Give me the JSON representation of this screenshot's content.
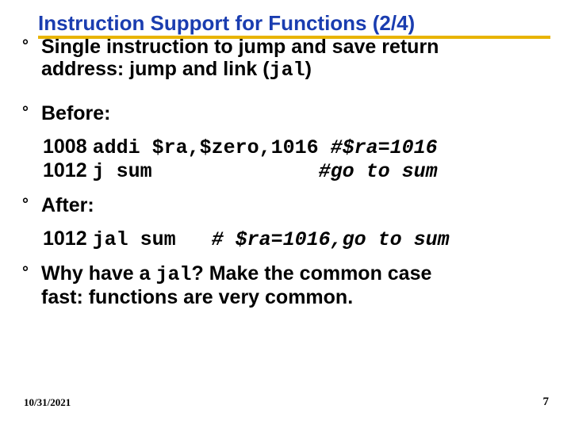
{
  "title": "Instruction Support for Functions (2/4)",
  "bullets": {
    "intro_line1": "Single instruction to jump and save return",
    "intro_line2_a": "address: jump and link (",
    "intro_line2_b": "jal",
    "intro_line2_c": ")",
    "before": "Before:",
    "after": "After:",
    "why_a": "Why have a ",
    "why_b": "jal",
    "why_c": "? Make the common case",
    "why_d": "fast: functions are very common."
  },
  "code_before": {
    "line1_addr": "1008 ",
    "line1_code": "addi $ra,$zero,1016 ",
    "line1_comment": "#$ra=1016",
    "line2_addr": "1012 ",
    "line2_code": "j sum              ",
    "line2_comment": "#go to sum"
  },
  "code_after": {
    "line1_addr": "1012 ",
    "line1_code": "jal sum   ",
    "line1_comment": "# $ra=1016,go to sum"
  },
  "footer": {
    "date": "10/31/2021",
    "page": "7"
  }
}
